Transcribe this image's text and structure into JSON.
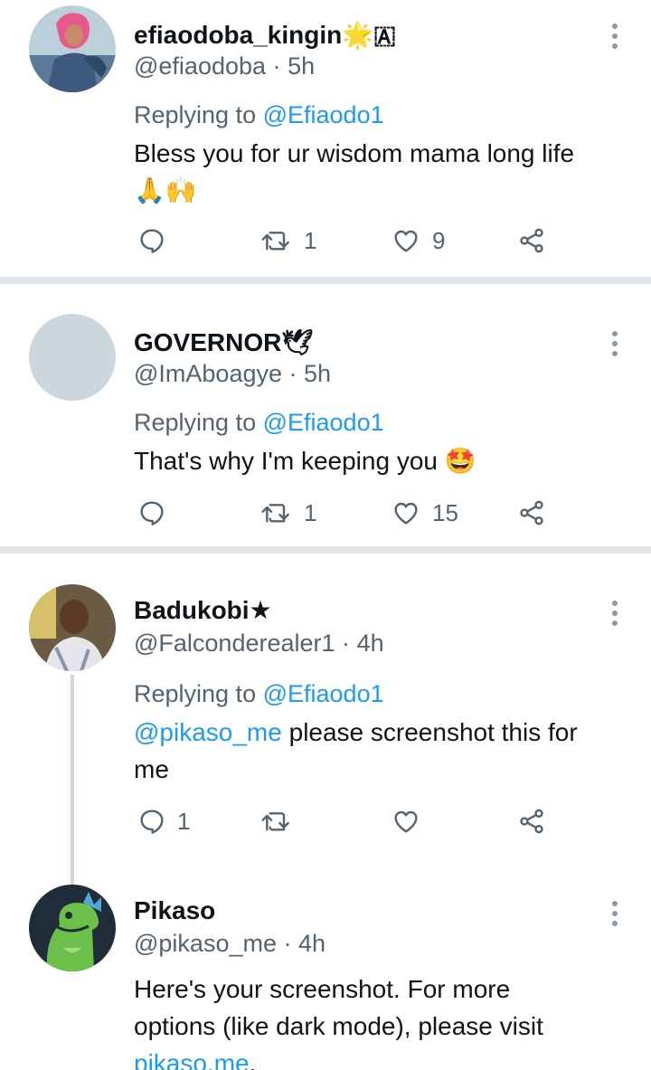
{
  "tweets": [
    {
      "name": "efiaodoba_kingin🌟🇦",
      "handle": "@efiaodoba",
      "time": "5h",
      "replying_label": "Replying to",
      "replying_to": "@Efiaodo1",
      "text": "Bless you for ur wisdom mama long life",
      "text_line2": "🙏🙌",
      "replies": "",
      "retweets": "1",
      "likes": "9"
    },
    {
      "name": "GOVERNOR🕊",
      "handle": "@ImAboagye",
      "time": "5h",
      "replying_label": "Replying to",
      "replying_to": "@Efiaodo1",
      "text": "That's why I'm keeping you 🤩",
      "replies": "",
      "retweets": "1",
      "likes": "15"
    },
    {
      "name": "Badukobi★",
      "handle": "@Falconderealer1",
      "time": "4h",
      "replying_label": "Replying to",
      "replying_to": "@Efiaodo1",
      "text_mention": "@pikaso_me",
      "text": " please screenshot this for",
      "text_line2": "me",
      "replies": "1",
      "retweets": "",
      "likes": ""
    },
    {
      "name": "Pikaso",
      "handle": "@pikaso_me",
      "time": "4h",
      "text": "Here's your screenshot. For more",
      "text_line2": "options (like dark mode), please visit",
      "link": "pikaso.me",
      "link_suffix": "."
    }
  ],
  "dot": "·",
  "colors": {
    "accent": "#1d9bf0",
    "secondary_text": "#536471",
    "separator": "#e1e6ea"
  }
}
